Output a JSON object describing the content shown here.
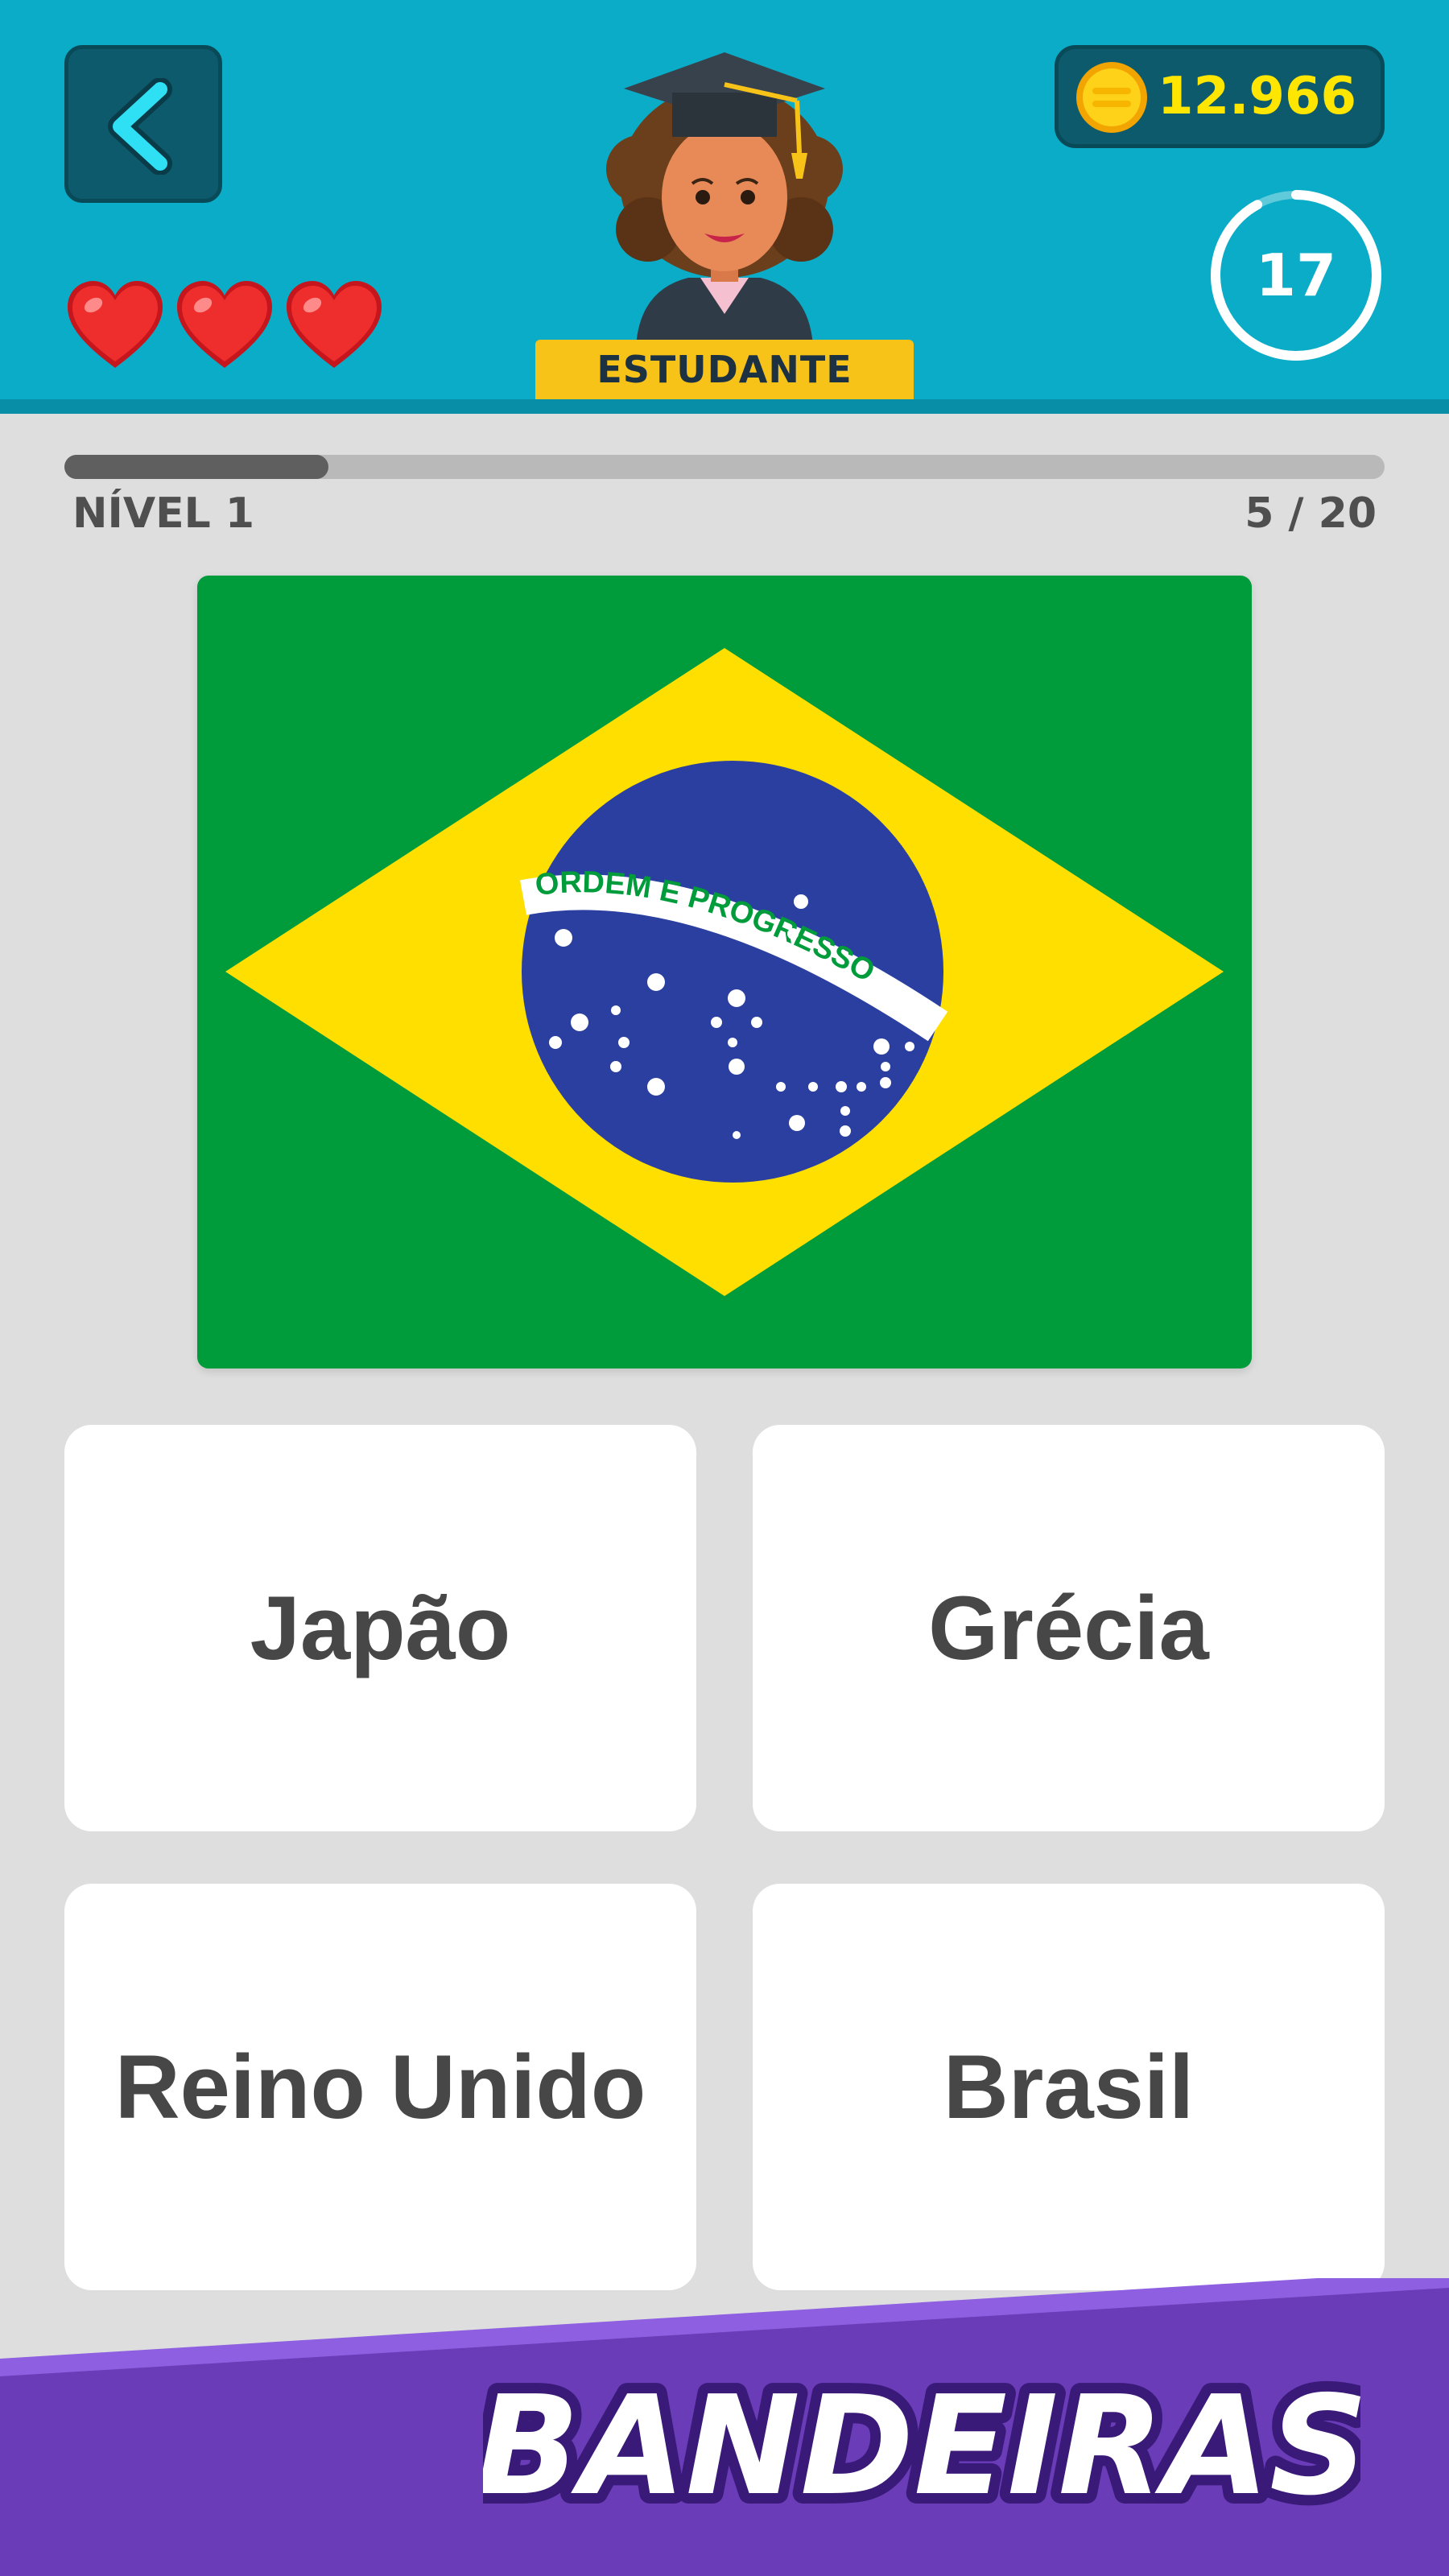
{
  "header": {
    "back_icon": "chevron-left-icon",
    "lives": 3,
    "heart_icon": "heart-icon",
    "rank": "ESTUDANTE",
    "coins": "12.966",
    "coin_icon": "coin-icon",
    "timer": "17",
    "timer_fraction": 0.92
  },
  "progress": {
    "level_label": "NÍVEL 1",
    "count": "5 / 20",
    "fraction": 0.2
  },
  "question": {
    "flag": "brazil-flag",
    "flag_motto": "ORDEM E PROGRESSO"
  },
  "answers": [
    "Japão",
    "Grécia",
    "Reino Unido",
    "Brasil"
  ],
  "footer": {
    "title": "BANDEIRAS"
  },
  "colors": {
    "header": "#0bacc7",
    "accent_yellow": "#ffe600",
    "footer_purple": "#6a3cb8",
    "flag_green": "#009c3b",
    "flag_yellow": "#ffdf00",
    "flag_blue": "#2a3f9f"
  }
}
